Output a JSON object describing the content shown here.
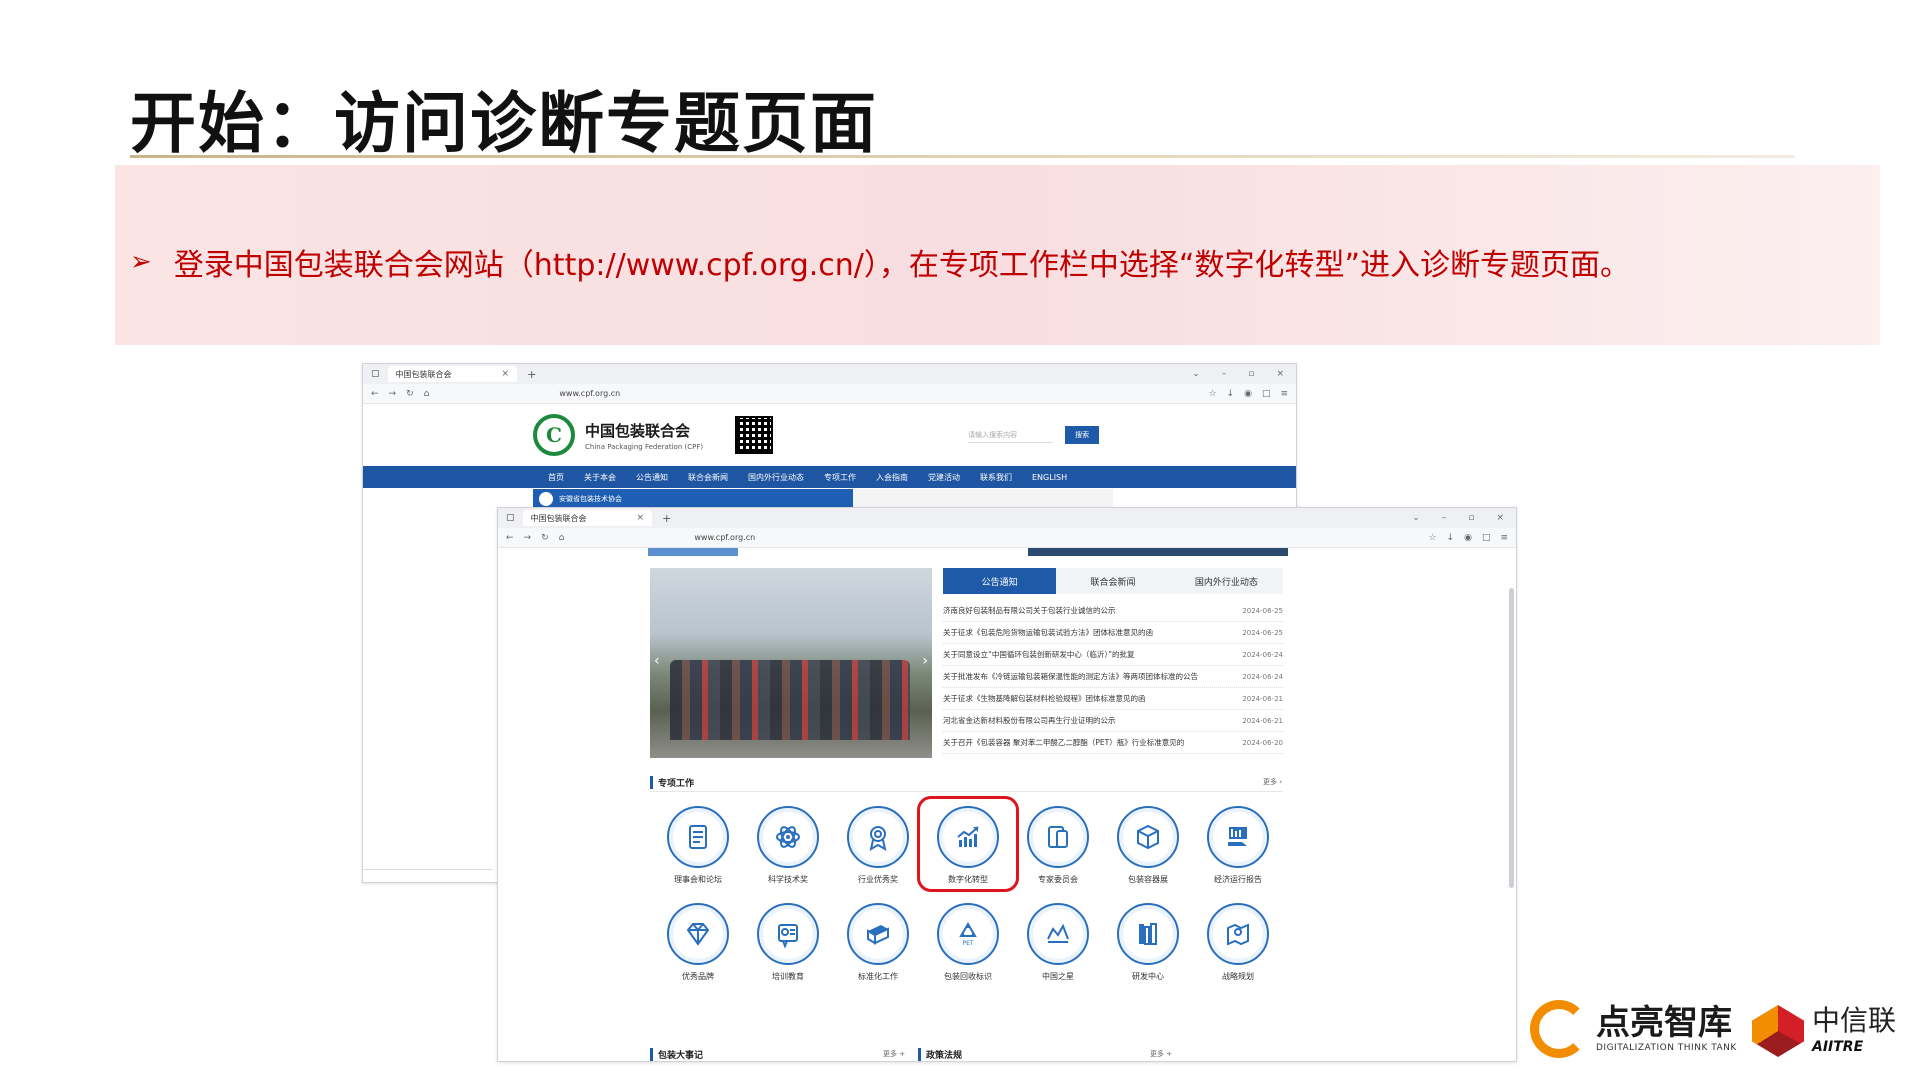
{
  "slide": {
    "title": "开始：访问诊断专题页面",
    "bullet": "登录中国包装联合会网站（http://www.cpf.org.cn/），在专项工作栏中选择“数字化转型”进入诊断专题页面。"
  },
  "back_window": {
    "tab_title": "中国包装联合会",
    "url": "www.cpf.org.cn",
    "org_name": "中国包装联合会",
    "org_name_en": "China Packaging Federation (CPF)",
    "search_placeholder": "请输入搜索内容",
    "search_button": "搜索",
    "nav": [
      "首页",
      "关于本会",
      "公告通知",
      "联合会新闻",
      "国内外行业动态",
      "专项工作",
      "入会指南",
      "党建活动",
      "联系我们",
      "ENGLISH"
    ],
    "strip_text": "安徽省包装技术协会"
  },
  "front_window": {
    "tab_title": "中国包装联合会",
    "url": "www.cpf.org.cn",
    "news_tabs": [
      "公告通知",
      "联合会新闻",
      "国内外行业动态"
    ],
    "news": [
      {
        "title": "济南良好包装制品有限公司关于包装行业诚信的公示",
        "date": "2024-06-25"
      },
      {
        "title": "关于征求《包装危险货物运输包装试验方法》团体标准意见的函",
        "date": "2024-06-25"
      },
      {
        "title": "关于同意设立“中国循环包装创新研发中心（临沂）”的批复",
        "date": "2024-06-24"
      },
      {
        "title": "关于批准发布《冷链运输包装箱保温性能的测定方法》等两项团体标准的公告",
        "date": "2024-06-24"
      },
      {
        "title": "关于征求《生物基降解包装材料检验规程》团体标准意见的函",
        "date": "2024-06-21"
      },
      {
        "title": "河北省金达新材料股份有限公司再生行业证明的公示",
        "date": "2024-06-21"
      },
      {
        "title": "关于召开《包装容器 聚对苯二甲酸乙二醇酯（PET）瓶》行业标准意见的",
        "date": "2024-06-20"
      }
    ],
    "section_title": "专项工作",
    "section_more": "更多 ›",
    "icons": [
      {
        "label": "理事会和论坛",
        "icon": "document-icon"
      },
      {
        "label": "科学技术奖",
        "icon": "atom-icon"
      },
      {
        "label": "行业优秀奖",
        "icon": "medal-icon"
      },
      {
        "label": "数字化转型",
        "icon": "trend-chart-icon"
      },
      {
        "label": "专家委员会",
        "icon": "tablet-icon"
      },
      {
        "label": "包装容器展",
        "icon": "box-icon"
      },
      {
        "label": "经济运行报告",
        "icon": "monitor-hand-icon"
      },
      {
        "label": "优秀品牌",
        "icon": "diamond-icon"
      },
      {
        "label": "培训教育",
        "icon": "certificate-icon"
      },
      {
        "label": "标准化工作",
        "icon": "books-icon"
      },
      {
        "label": "包装回收标识",
        "icon": "recycle-icon"
      },
      {
        "label": "中国之星",
        "icon": "crown-chart-icon"
      },
      {
        "label": "研发中心",
        "icon": "bookshelf-icon"
      },
      {
        "label": "战略规划",
        "icon": "map-pin-icon"
      }
    ],
    "bottom_sections": [
      {
        "title": "包装大事记",
        "more": "更多 +"
      },
      {
        "title": "政策法规",
        "more": "更多 +"
      }
    ]
  },
  "footer": {
    "brand1_zh": "点亮智库",
    "brand1_en": "DIGITALIZATION THINK TANK",
    "brand2_zh": "中信联",
    "brand2_en": "AIITRE"
  },
  "colors": {
    "accent_red": "#c00000",
    "site_blue": "#1e56a3",
    "highlight": "#e0141b"
  }
}
